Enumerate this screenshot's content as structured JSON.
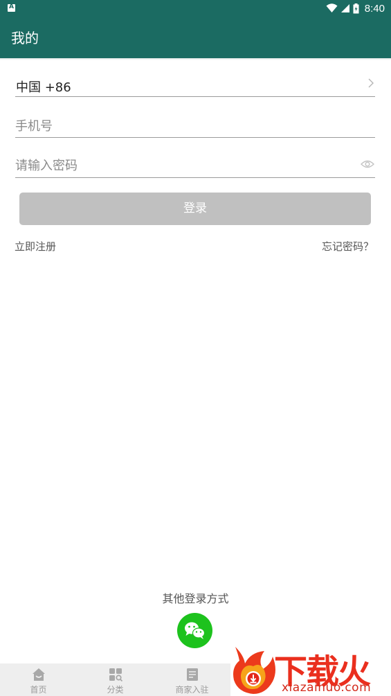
{
  "status_bar": {
    "time": "8:40"
  },
  "app_bar": {
    "title": "我的"
  },
  "login_form": {
    "country_code": "中国 +86",
    "phone_placeholder": "手机号",
    "password_placeholder": "请输入密码",
    "login_label": "登录",
    "register_link": "立即注册",
    "forgot_link": "忘记密码？"
  },
  "other_login": {
    "title": "其他登录方式",
    "wechat_icon": "wechat-icon"
  },
  "bottom_nav": {
    "items": [
      {
        "label": "首页",
        "icon": "home-icon"
      },
      {
        "label": "分类",
        "icon": "category-icon"
      },
      {
        "label": "商家入驻",
        "icon": "document-icon"
      }
    ]
  },
  "watermark": {
    "brand": "下载火",
    "url": "xiazaihuo.com"
  },
  "colors": {
    "primary": "#1b6b62",
    "button_disabled": "#c0c0c0",
    "wechat": "#1dc21d",
    "watermark": "#ea2f1e"
  }
}
